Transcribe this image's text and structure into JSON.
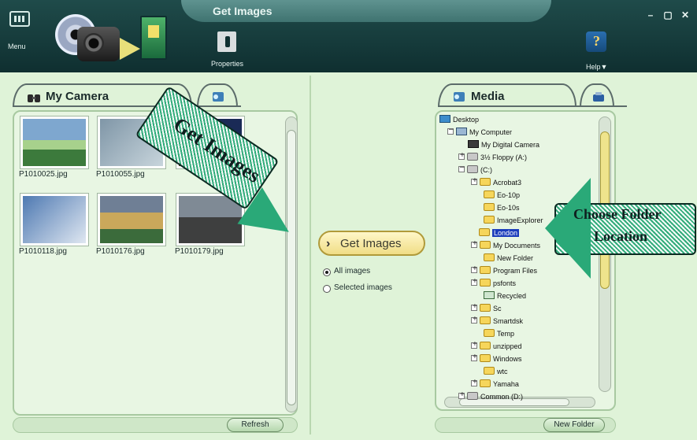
{
  "window": {
    "title": "Get Images",
    "controls": {
      "minimize": "–",
      "maximize": "▢",
      "close": "✕"
    }
  },
  "header": {
    "menu_label": "Menu",
    "properties_label": "Properties",
    "help_label": "Help▼"
  },
  "left": {
    "tab_label": "My Camera",
    "thumbs": [
      {
        "name": "P1010025.jpg"
      },
      {
        "name": "P1010055.jpg"
      },
      {
        "name": ""
      },
      {
        "name": "P1010118.jpg"
      },
      {
        "name": "P1010176.jpg"
      },
      {
        "name": "P1010179.jpg"
      }
    ],
    "refresh_label": "Refresh"
  },
  "center": {
    "get_images_label": "Get Images",
    "radio_all_label": "All images",
    "radio_selected_label": "Selected images"
  },
  "right": {
    "tab_label": "Media",
    "new_folder_label": "New Folder",
    "tree": [
      {
        "label": "Desktop",
        "icon": "desktop-icon"
      },
      {
        "label": "My Computer",
        "icon": "computer-icon"
      },
      {
        "label": "My Digital Camera",
        "icon": "camera-icon"
      },
      {
        "label": "3½ Floppy (A:)",
        "icon": "drive-icon"
      },
      {
        "label": "(C:)",
        "icon": "drive-icon"
      },
      {
        "label": "Acrobat3",
        "icon": "folder-icon"
      },
      {
        "label": "Eo-10p",
        "icon": "folder-icon"
      },
      {
        "label": "Eo-10s",
        "icon": "folder-icon"
      },
      {
        "label": "ImageExplorer",
        "icon": "folder-icon"
      },
      {
        "label": "London",
        "icon": "folder-icon",
        "selected": true
      },
      {
        "label": "My Documents",
        "icon": "folder-icon"
      },
      {
        "label": "New Folder",
        "icon": "folder-icon"
      },
      {
        "label": "Program Files",
        "icon": "folder-icon"
      },
      {
        "label": "psfonts",
        "icon": "folder-icon"
      },
      {
        "label": "Recycled",
        "icon": "recycle-bin-icon"
      },
      {
        "label": "Sc",
        "icon": "folder-icon"
      },
      {
        "label": "Smartdsk",
        "icon": "folder-icon"
      },
      {
        "label": "Temp",
        "icon": "folder-icon"
      },
      {
        "label": "unzipped",
        "icon": "folder-icon"
      },
      {
        "label": "Windows",
        "icon": "folder-icon"
      },
      {
        "label": "wtc",
        "icon": "folder-icon"
      },
      {
        "label": "Yamaha",
        "icon": "folder-icon"
      },
      {
        "label": "Common (D:)",
        "icon": "drive-icon"
      }
    ]
  },
  "annotations": {
    "get_images": "Get Images",
    "choose_folder_line1": "Choose Folder",
    "choose_folder_line2": "Location"
  },
  "colors": {
    "header_bg": "#163a3a",
    "panel_bg": "#dff3d8",
    "accent_button": "#f0dd86",
    "tree_selection": "#1b3dbb"
  }
}
